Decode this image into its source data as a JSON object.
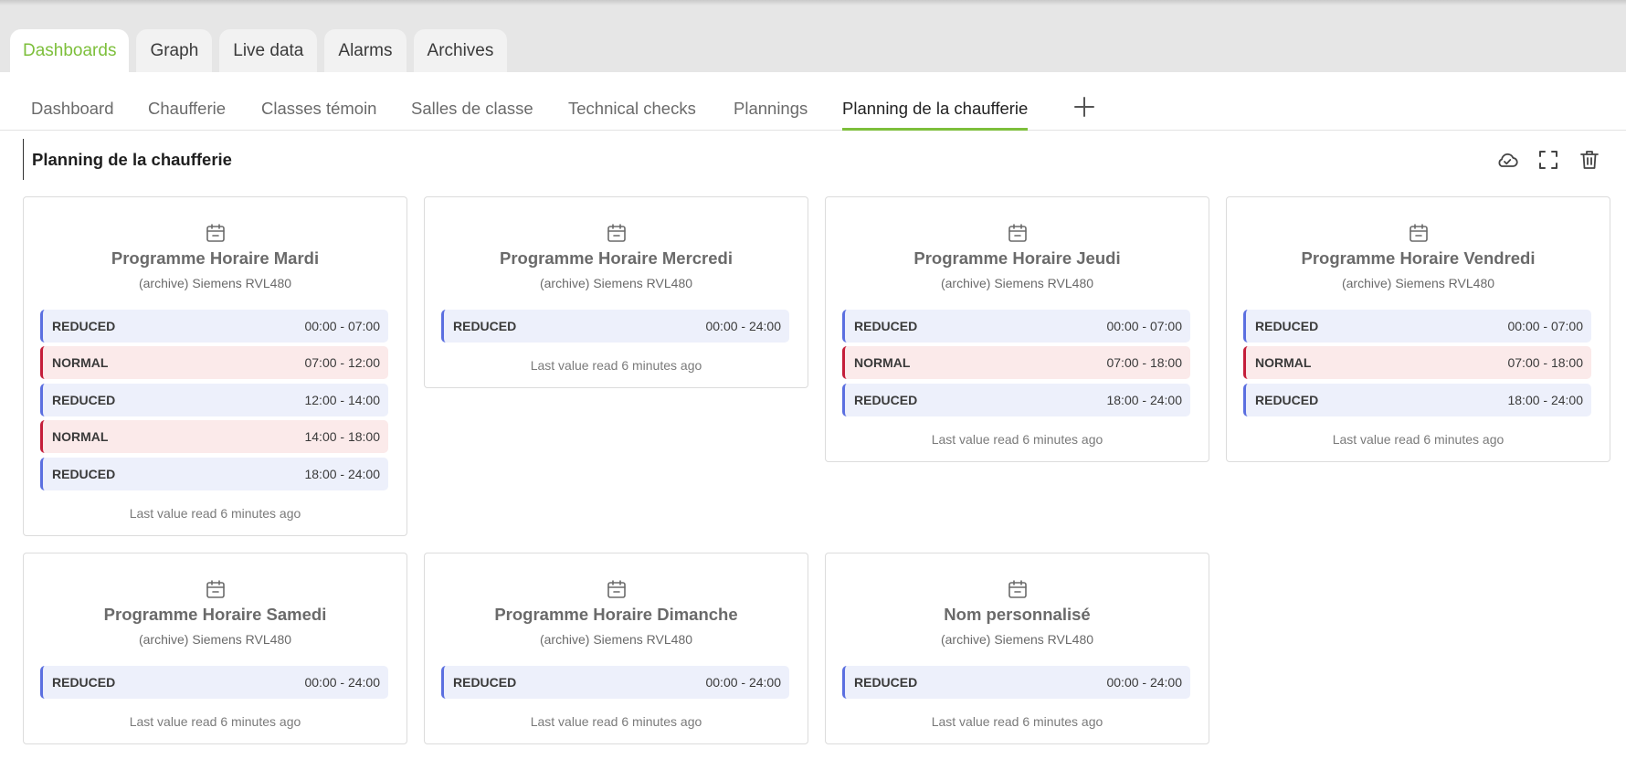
{
  "main_tabs": [
    {
      "label": "Dashboards",
      "active": true
    },
    {
      "label": "Graph"
    },
    {
      "label": "Live data"
    },
    {
      "label": "Alarms"
    },
    {
      "label": "Archives"
    }
  ],
  "sub_tabs": [
    {
      "label": "Dashboard"
    },
    {
      "label": "Chaufferie"
    },
    {
      "label": "Classes témoin"
    },
    {
      "label": "Salles de classe"
    },
    {
      "label": "Technical checks"
    },
    {
      "label": "Plannings"
    },
    {
      "label": "Planning de la chaufferie",
      "active": true
    }
  ],
  "page": {
    "title": "Planning de la chaufferie"
  },
  "toolbar_icons": [
    "cloud-check-icon",
    "fullscreen-icon",
    "trash-icon"
  ],
  "colors": {
    "accent": "#7dbf3b",
    "reduced_bar": "#5b6fe0",
    "reduced_bg": "#edf0fb",
    "normal_bar": "#c41e3a",
    "normal_bg": "#fbeaea"
  },
  "cards": [
    {
      "title": "Programme Horaire Mardi",
      "subtitle": "(archive) Siemens RVL480",
      "slots": [
        {
          "mode": "REDUCED",
          "time": "00:00 - 07:00"
        },
        {
          "mode": "NORMAL",
          "time": "07:00 - 12:00"
        },
        {
          "mode": "REDUCED",
          "time": "12:00 - 14:00"
        },
        {
          "mode": "NORMAL",
          "time": "14:00 - 18:00"
        },
        {
          "mode": "REDUCED",
          "time": "18:00 - 24:00"
        }
      ],
      "footer": "Last value read 6 minutes ago"
    },
    {
      "title": "Programme Horaire Mercredi",
      "subtitle": "(archive) Siemens RVL480",
      "slots": [
        {
          "mode": "REDUCED",
          "time": "00:00 - 24:00"
        }
      ],
      "footer": "Last value read 6 minutes ago"
    },
    {
      "title": "Programme Horaire Jeudi",
      "subtitle": "(archive) Siemens RVL480",
      "slots": [
        {
          "mode": "REDUCED",
          "time": "00:00 - 07:00"
        },
        {
          "mode": "NORMAL",
          "time": "07:00 - 18:00"
        },
        {
          "mode": "REDUCED",
          "time": "18:00 - 24:00"
        }
      ],
      "footer": "Last value read 6 minutes ago"
    },
    {
      "title": "Programme Horaire Vendredi",
      "subtitle": "(archive) Siemens RVL480",
      "slots": [
        {
          "mode": "REDUCED",
          "time": "00:00 - 07:00"
        },
        {
          "mode": "NORMAL",
          "time": "07:00 - 18:00"
        },
        {
          "mode": "REDUCED",
          "time": "18:00 - 24:00"
        }
      ],
      "footer": "Last value read 6 minutes ago"
    },
    {
      "title": "Programme Horaire Samedi",
      "subtitle": "(archive) Siemens RVL480",
      "slots": [
        {
          "mode": "REDUCED",
          "time": "00:00 - 24:00"
        }
      ],
      "footer": "Last value read 6 minutes ago"
    },
    {
      "title": "Programme Horaire Dimanche",
      "subtitle": "(archive) Siemens RVL480",
      "slots": [
        {
          "mode": "REDUCED",
          "time": "00:00 - 24:00"
        }
      ],
      "footer": "Last value read 6 minutes ago"
    },
    {
      "title": "Nom personnalisé",
      "subtitle": "(archive) Siemens RVL480",
      "slots": [
        {
          "mode": "REDUCED",
          "time": "00:00 - 24:00"
        }
      ],
      "footer": "Last value read 6 minutes ago"
    }
  ]
}
